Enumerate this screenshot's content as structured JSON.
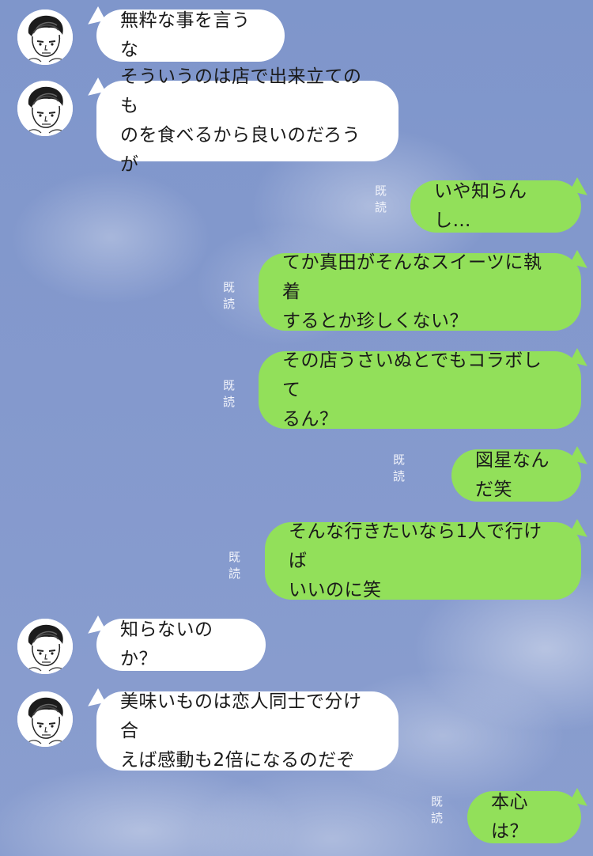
{
  "chat": {
    "colors": {
      "background": "#8499cd",
      "incoming_bubble": "#ffffff",
      "outgoing_bubble": "#92e05a",
      "text": "#1a1a1a",
      "read_label": "#f2f4fb"
    },
    "read_label": "既読",
    "avatar_icon": "sketch-portrait-icon",
    "messages": [
      {
        "side": "left",
        "text": "無粋な事を言うな"
      },
      {
        "side": "left",
        "text": "そういうのは店で出来立てのも\nのを食べるから良いのだろうが"
      },
      {
        "side": "right",
        "read": "既読",
        "text": "いや知らんし…"
      },
      {
        "side": "right",
        "read": "既読",
        "text": "てか真田がそんなスイーツに執着\nするとか珍しくない？"
      },
      {
        "side": "right",
        "read": "既読",
        "text": "その店うさいぬとでもコラボして\nるん？"
      },
      {
        "side": "right",
        "read": "既読",
        "text": "図星なんだ笑"
      },
      {
        "side": "right",
        "read": "既読",
        "text": "そんな行きたいなら1人で行けば\nいいのに笑"
      },
      {
        "side": "left",
        "text": "知らないのか？"
      },
      {
        "side": "left",
        "text": "美味いものは恋人同士で分け合\nえば感動も2倍になるのだぞ"
      },
      {
        "side": "right",
        "read": "既読",
        "text": "本心は？"
      }
    ]
  }
}
